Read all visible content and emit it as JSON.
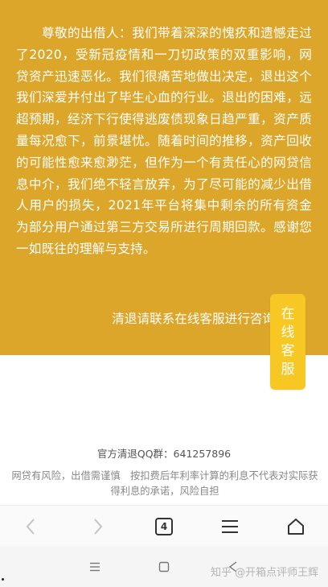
{
  "notice": {
    "body": "尊敬的出借人：我们带着深深的愧疚和遗憾走过了2020，受新冠疫情和一刀切政策的双重影响，网贷资产迅速恶化。我们很痛苦地做出决定，退出这个我们深爱并付出了毕生心血的行业。退出的困难，远超预期，经济下行使得逃废债现象日趋严重，资产质量每况愈下，前景堪忧。随着时间的推移，资产回收的可能性愈来愈渺茫，但作为一个有责任心的网贷信息中介，我们绝不轻言放弃，为了尽可能的减少出借人用户的损失，2021年平台将集中剩余的所有资金为部分用户通过第三方交易所进行周期回款。感谢您一如既往的理解与支持。",
    "contact": "清退请联系在线客服进行咨询"
  },
  "cs_button": {
    "label": "在线客服"
  },
  "footer": {
    "qq": "官方清退QQ群：641257896",
    "risk": "网贷有风险，出借需谨慎　按扣费后年利率计算的利息不代表对实际获得利息的承诺，风险自担"
  },
  "toolbar": {
    "tab_count": "4"
  },
  "watermark": "知乎 @开箱点评师王辉",
  "colors": {
    "banner": "#dca62a",
    "button": "#f7c823"
  },
  "icons": [
    "back-arrow-icon",
    "forward-arrow-icon",
    "tabs-icon",
    "menu-icon",
    "home-icon",
    "recent-apps-icon",
    "system-home-icon",
    "system-back-icon"
  ]
}
